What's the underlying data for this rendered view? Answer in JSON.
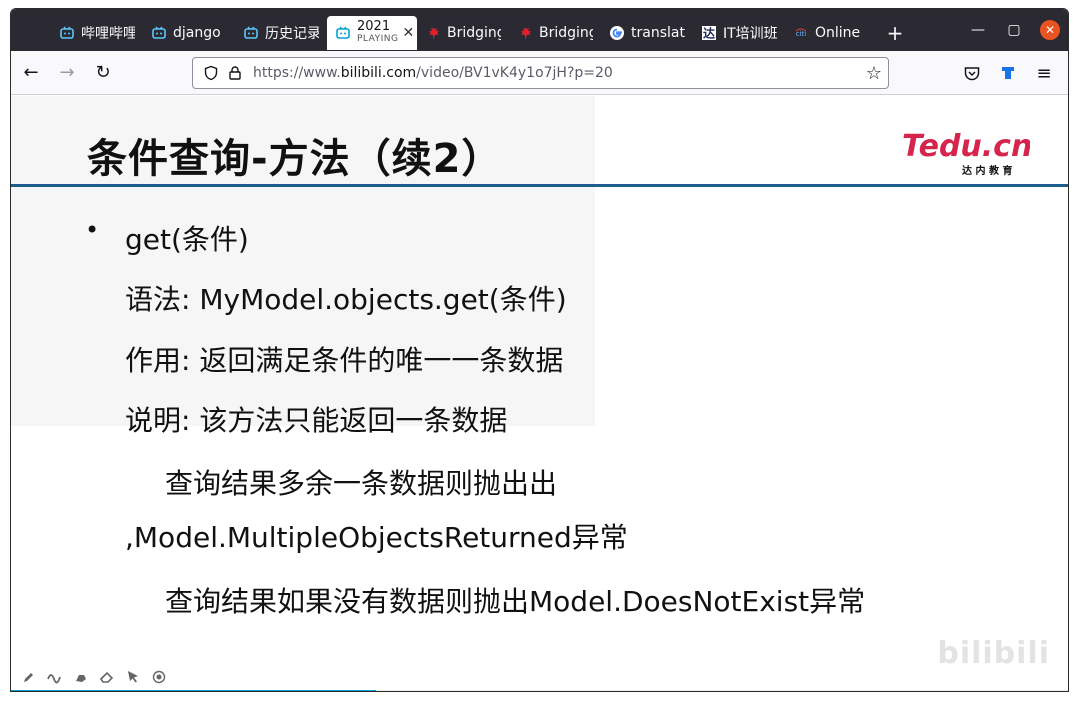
{
  "browser": {
    "tabs": [
      {
        "label": "哔哩哔哩",
        "icon": "bilibili-icon"
      },
      {
        "label": "django",
        "icon": "bilibili-icon"
      },
      {
        "label": "历史记录",
        "icon": "bilibili-icon"
      },
      {
        "label": "2021",
        "sublabel": "PLAYING",
        "icon": "bilibili-icon",
        "active": true
      },
      {
        "label": "Bridging",
        "icon": "maple-leaf-icon"
      },
      {
        "label": "Bridging",
        "icon": "maple-leaf-icon"
      },
      {
        "label": "translate",
        "icon": "google-icon"
      },
      {
        "label": "IT培训班",
        "icon": "tedu-icon"
      },
      {
        "label": "Online",
        "icon": "citi-icon"
      }
    ],
    "new_tab": "+",
    "url_prefix": "https://www.",
    "url_domain": "bilibili.com",
    "url_path": "/video/BV1vK4y1o7jH?p=20"
  },
  "slide": {
    "title": "条件查询-方法（续2）",
    "logo_text": "Tedu.cn",
    "logo_sub": "达 内 教 育",
    "bullet": "•",
    "lines": {
      "l1": "get(条件)",
      "l2": "语法: MyModel.objects.get(条件)",
      "l3": "作用: 返回满足条件的唯一一条数据",
      "l4": "说明: 该方法只能返回一条数据",
      "l5": "查询结果多余一条数据则抛出出",
      "l6": ",Model.MultipleObjectsReturned异常",
      "l7": "查询结果如果没有数据则抛出Model.DoesNotExist异常"
    },
    "watermark": "bilibili"
  },
  "player": {
    "tools": [
      "pencil-icon",
      "wave-icon",
      "highlighter-icon",
      "eraser-icon",
      "pointer-icon",
      "record-icon"
    ],
    "progress": 0.345,
    "accent": "#00a1d6"
  }
}
